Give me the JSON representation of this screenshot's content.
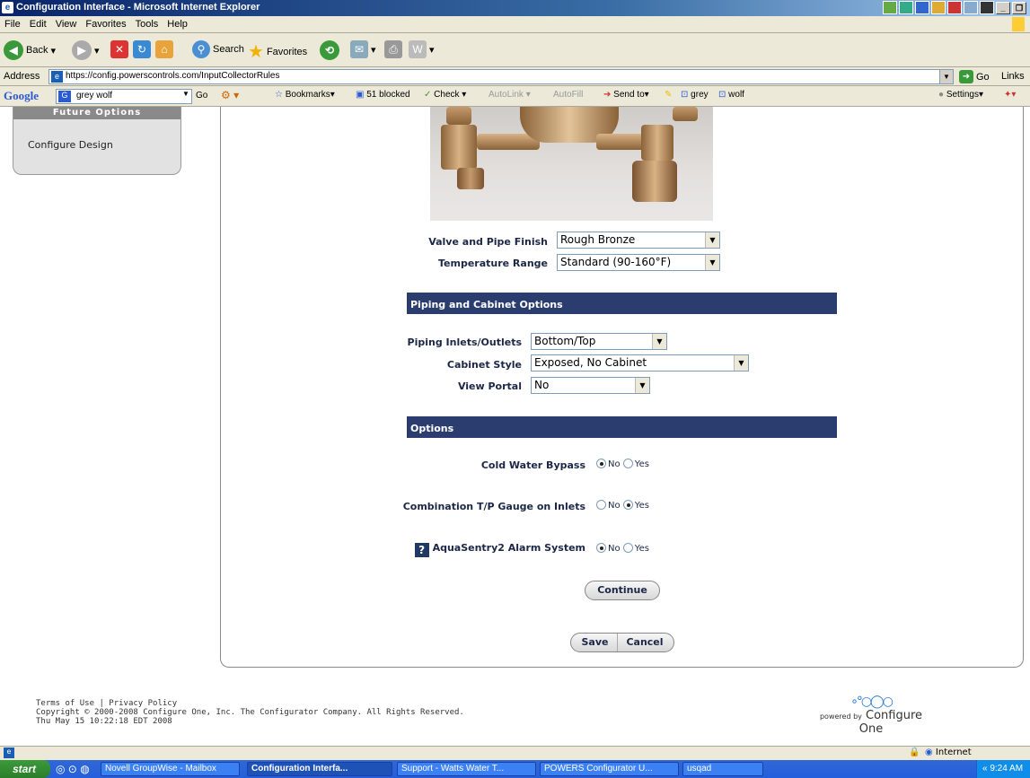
{
  "window": {
    "title": "Configuration Interface - Microsoft Internet Explorer"
  },
  "menu": [
    "File",
    "Edit",
    "View",
    "Favorites",
    "Tools",
    "Help"
  ],
  "toolbar": {
    "back": "Back",
    "search": "Search",
    "favorites": "Favorites"
  },
  "address": {
    "label": "Address",
    "url": "https://config.powerscontrols.com/InputCollectorRules",
    "go": "Go",
    "links": "Links"
  },
  "google_bar": {
    "logo": "Google",
    "query": "grey wolf",
    "go": "Go",
    "bookmarks": "Bookmarks",
    "blocked": "51 blocked",
    "check": "Check",
    "autolink": "AutoLink",
    "autofill": "AutoFill",
    "send_to": "Send to",
    "term1": "grey",
    "term2": "wolf",
    "settings": "Settings"
  },
  "sidebar": {
    "header": "Future Options",
    "link": "Configure Design"
  },
  "form": {
    "valve_finish": {
      "label": "Valve and Pipe Finish",
      "value": "Rough Bronze"
    },
    "temperature": {
      "label": "Temperature Range",
      "value": "Standard (90-160°F)"
    },
    "section_piping": "Piping and Cabinet Options",
    "piping": {
      "label": "Piping Inlets/Outlets",
      "value": "Bottom/Top"
    },
    "cabinet": {
      "label": "Cabinet Style",
      "value": "Exposed, No Cabinet"
    },
    "portal": {
      "label": "View Portal",
      "value": "No"
    },
    "section_options": "Options",
    "bypass": {
      "label": "Cold Water Bypass",
      "selected": "No"
    },
    "gauge": {
      "label": "Combination T/P Gauge on Inlets",
      "selected": "Yes"
    },
    "alarm": {
      "label": "AquaSentry2 Alarm System",
      "selected": "No"
    },
    "radio_no": "No",
    "radio_yes": "Yes",
    "continue": "Continue",
    "save": "Save",
    "cancel": "Cancel"
  },
  "footer": {
    "links": "Terms of Use | Privacy Policy",
    "copyright": "Copyright © 2000-2008 Configure One, Inc. The Configurator Company. All Rights Reserved.",
    "timestamp": "Thu May 15 10:22:18 EDT 2008",
    "powered": "powered by",
    "brand": "Configure One"
  },
  "status": {
    "zone": "Internet"
  },
  "taskbar": {
    "start": "start",
    "tasks": [
      "Novell GroupWise - Mailbox",
      "Configuration Interfa...",
      "Support - Watts Water T...",
      "POWERS Configurator U...",
      "usqad"
    ],
    "clock": "9:24 AM"
  }
}
